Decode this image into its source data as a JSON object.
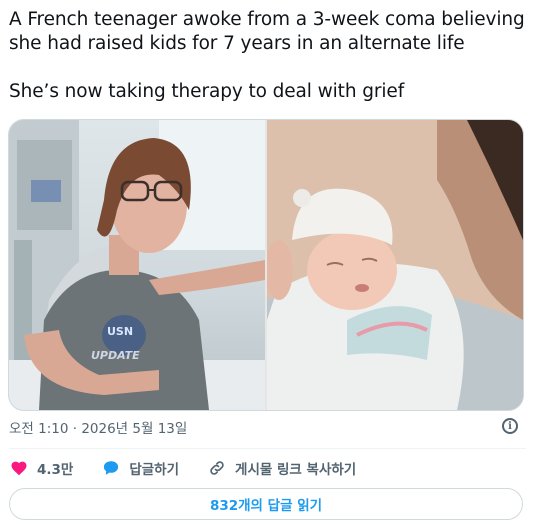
{
  "tweet": {
    "line1": "A French teenager awoke from a 3-week coma believing she had raised kids for 7 years in an alternate life",
    "line2": "She’s now taking therapy to deal with grief"
  },
  "media": {
    "left_shirt_text": "UPDATE",
    "left_logo_text": "USN"
  },
  "meta": {
    "timestamp": "오전 1:10 · 2026년 5월 13일",
    "info_glyph": "i"
  },
  "actions": {
    "like_count": "4.3만",
    "reply_label": "답글하기",
    "copy_link_label": "게시물 링크 복사하기"
  },
  "read_replies": {
    "label": "832개의 답글 읽기"
  },
  "colors": {
    "like": "#f91880",
    "reply": "#1d9bf0",
    "link": "#1d9bf0",
    "muted": "#536471"
  }
}
